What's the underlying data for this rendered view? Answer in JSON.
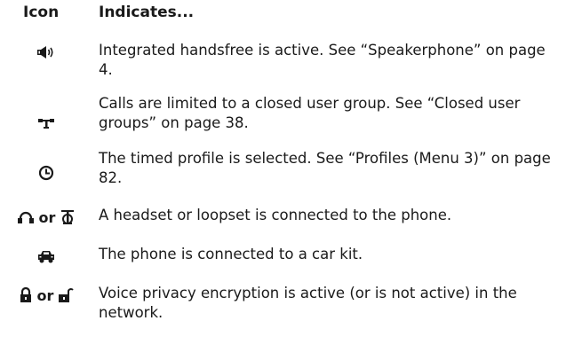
{
  "table": {
    "header": {
      "icon": "Icon",
      "indicates": "Indicates..."
    },
    "rows": [
      {
        "icons": [
          "speaker-icon"
        ],
        "text": "Integrated handsfree is active. See “Speakerphone” on page 4."
      },
      {
        "icons": [
          "closed-user-group-icon"
        ],
        "text": "Calls are limited to a closed user group. See “Closed user groups” on page 38."
      },
      {
        "icons": [
          "timed-profile-clock-icon"
        ],
        "text": "The timed profile is selected. See “Profiles (Menu 3)” on page 82."
      },
      {
        "icons": [
          "headset-icon",
          "loopset-icon"
        ],
        "or": "or",
        "text": "A headset or loopset is connected to the phone."
      },
      {
        "icons": [
          "car-kit-icon"
        ],
        "text": "The phone is connected to a car kit."
      },
      {
        "icons": [
          "lock-closed-icon",
          "lock-open-icon"
        ],
        "or": "or",
        "text": "Voice privacy encryption is active (or is not active) in the network."
      }
    ]
  }
}
